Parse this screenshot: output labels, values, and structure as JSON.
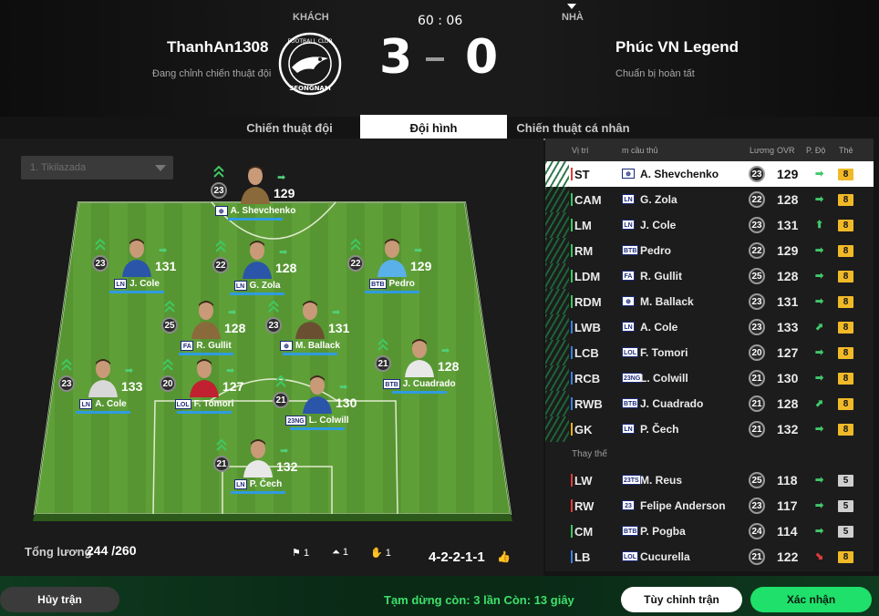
{
  "header": {
    "away_label": "KHÁCH",
    "home_label": "NHÀ",
    "away_team": "ThanhAn1308",
    "away_status": "Đang chỉnh chiến thuật đội",
    "home_team": "Phúc VN Legend",
    "home_status": "Chuẩn bị hoàn tất",
    "timer": "60 : 06",
    "score_away": "3",
    "score_home": "0",
    "logo_text": "FOOTBALL CLUB SEONGNAM"
  },
  "tabs": [
    {
      "label": "Chiến thuật đội",
      "active": false
    },
    {
      "label": "Đội hình",
      "active": true
    },
    {
      "label": "Chiến thuật cá nhân",
      "active": false
    }
  ],
  "formation_select": "1. Tikilazada",
  "pitch_players": [
    {
      "name": "A. Shevchenko",
      "lvl": "23",
      "ovr": "129",
      "tag": "⊕"
    },
    {
      "name": "J. Cole",
      "lvl": "23",
      "ovr": "131",
      "tag": "LN"
    },
    {
      "name": "G. Zola",
      "lvl": "22",
      "ovr": "128",
      "tag": "LN"
    },
    {
      "name": "Pedro",
      "lvl": "22",
      "ovr": "129",
      "tag": "BTB"
    },
    {
      "name": "R. Gullit",
      "lvl": "25",
      "ovr": "128",
      "tag": "FA"
    },
    {
      "name": "M. Ballack",
      "lvl": "23",
      "ovr": "131",
      "tag": "⊕"
    },
    {
      "name": "A. Cole",
      "lvl": "23",
      "ovr": "133",
      "tag": "LN"
    },
    {
      "name": "F. Tomori",
      "lvl": "20",
      "ovr": "127",
      "tag": "LOL"
    },
    {
      "name": "L. Colwill",
      "lvl": "21",
      "ovr": "130",
      "tag": "23NG"
    },
    {
      "name": "J. Cuadrado",
      "lvl": "21",
      "ovr": "128",
      "tag": "BTB"
    },
    {
      "name": "P. Čech",
      "lvl": "21",
      "ovr": "132",
      "tag": "LN"
    }
  ],
  "footer_stats": {
    "wage_label": "Tổng lương",
    "wage_value": "244 /260",
    "stat1": "1",
    "stat2": "1",
    "stat3": "1",
    "formation": "4-2-2-1-1"
  },
  "list": {
    "headers": {
      "pos": "Vị trí",
      "name": "m cầu thủ",
      "wage": "Lương",
      "ovr": "OVR",
      "form": "P. Độ",
      "card": "Thẻ"
    },
    "starters": [
      {
        "pos": "ST",
        "tag": "⊕",
        "name": "A. Shevchenko",
        "lvl": "23",
        "ovr": "129",
        "form": "➡",
        "card": "8",
        "color": "#e23b3b"
      },
      {
        "pos": "CAM",
        "tag": "LN",
        "name": "G. Zola",
        "lvl": "22",
        "ovr": "128",
        "form": "➡",
        "card": "8",
        "color": "#3fc862"
      },
      {
        "pos": "LM",
        "tag": "LN",
        "name": "J. Cole",
        "lvl": "23",
        "ovr": "131",
        "form": "⬆",
        "card": "8",
        "color": "#3fc862"
      },
      {
        "pos": "RM",
        "tag": "BTB",
        "name": "Pedro",
        "lvl": "22",
        "ovr": "129",
        "form": "➡",
        "card": "8",
        "color": "#3fc862"
      },
      {
        "pos": "LDM",
        "tag": "FA",
        "name": "R. Gullit",
        "lvl": "25",
        "ovr": "128",
        "form": "➡",
        "card": "8",
        "color": "#3fc862"
      },
      {
        "pos": "RDM",
        "tag": "⊕",
        "name": "M. Ballack",
        "lvl": "23",
        "ovr": "131",
        "form": "➡",
        "card": "8",
        "color": "#3fc862"
      },
      {
        "pos": "LWB",
        "tag": "LN",
        "name": "A. Cole",
        "lvl": "23",
        "ovr": "133",
        "form": "⬈",
        "card": "8",
        "color": "#3b82e0"
      },
      {
        "pos": "LCB",
        "tag": "LOL",
        "name": "F. Tomori",
        "lvl": "20",
        "ovr": "127",
        "form": "➡",
        "card": "8",
        "color": "#3b82e0"
      },
      {
        "pos": "RCB",
        "tag": "23NG",
        "name": "L. Colwill",
        "lvl": "21",
        "ovr": "130",
        "form": "➡",
        "card": "8",
        "color": "#3b82e0"
      },
      {
        "pos": "RWB",
        "tag": "BTB",
        "name": "J. Cuadrado",
        "lvl": "21",
        "ovr": "128",
        "form": "⬈",
        "card": "8",
        "color": "#3b82e0"
      },
      {
        "pos": "GK",
        "tag": "LN",
        "name": "P. Čech",
        "lvl": "21",
        "ovr": "132",
        "form": "➡",
        "card": "8",
        "color": "#e8b21f"
      }
    ],
    "sub_label": "Thay thế",
    "subs": [
      {
        "pos": "LW",
        "tag": "23TS",
        "name": "M. Reus",
        "lvl": "25",
        "ovr": "118",
        "form": "➡",
        "card": "5",
        "color": "#e23b3b"
      },
      {
        "pos": "RW",
        "tag": "23",
        "name": "Felipe Anderson",
        "lvl": "23",
        "ovr": "117",
        "form": "➡",
        "card": "5",
        "color": "#e23b3b"
      },
      {
        "pos": "CM",
        "tag": "BTB",
        "name": "P. Pogba",
        "lvl": "24",
        "ovr": "114",
        "form": "➡",
        "card": "5",
        "color": "#3fc862"
      },
      {
        "pos": "LB",
        "tag": "LOL",
        "name": "Cucurella",
        "lvl": "21",
        "ovr": "122",
        "form": "⬊",
        "card": "8",
        "color": "#3b82e0"
      }
    ]
  },
  "footer": {
    "cancel": "Hủy trận",
    "pause_text": "Tạm dừng còn: 3 lần   Còn: 13 giây",
    "adjust": "Tùy chỉnh trận",
    "confirm": "Xác nhận"
  },
  "colors": {
    "accent_green": "#1fe06a",
    "card_gold": "#f0b928",
    "card_silver": "#cfcfcf",
    "pitch_green": "#5a9a34"
  }
}
